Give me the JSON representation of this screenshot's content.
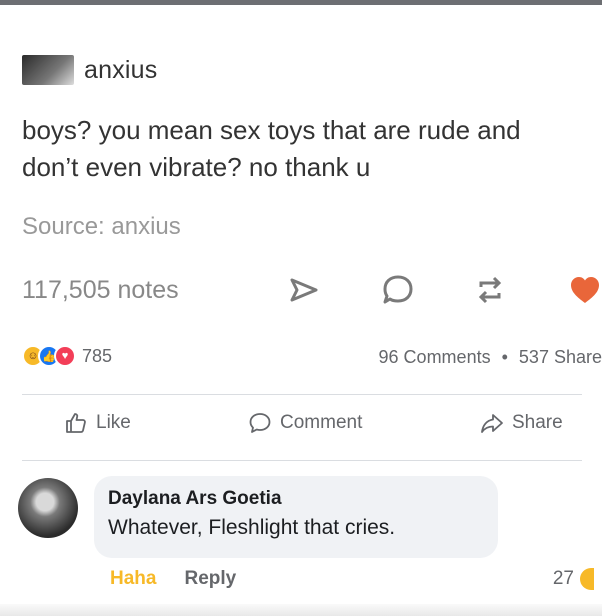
{
  "tumblr_post": {
    "username": "anxius",
    "body": "boys? you mean sex toys that are rude and don’t even vibrate? no thank u",
    "source": "Source: anxius",
    "notes": "117,505 notes",
    "icons": [
      "share-arrow-icon",
      "reply-bubble-icon",
      "reblog-icon",
      "heart-icon"
    ],
    "heart_color": "#e9663a",
    "icon_color": "#7a7a7a"
  },
  "facebook": {
    "reaction_count": "785",
    "comments_count": "96 Comments",
    "separator": "•",
    "shares_count": "537 Share",
    "actions": {
      "like": "Like",
      "comment": "Comment",
      "share": "Share"
    },
    "comment": {
      "author": "Daylana Ars Goetia",
      "text": "Whatever, Fleshlight that cries.",
      "haha": "Haha",
      "reply": "Reply",
      "reaction_count": "27"
    },
    "colors": {
      "haha": "#f7b928",
      "muted_text": "#65676b",
      "bubble": "#f0f2f5"
    }
  }
}
